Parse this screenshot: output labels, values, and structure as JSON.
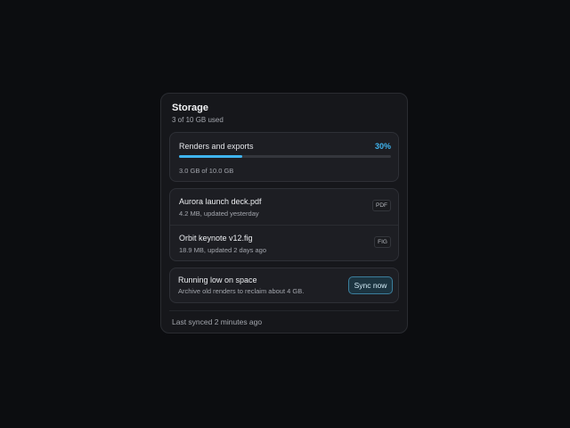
{
  "storage": {
    "title": "Storage",
    "subtitle": "3 of 10 GB used"
  },
  "usage": {
    "label": "Renders and exports",
    "percent_text": "30%",
    "fraction": 0.3,
    "detail": "3.0 GB of 10.0 GB",
    "accent_color": "#3fb4ef"
  },
  "files": [
    {
      "name": "Aurora launch deck.pdf",
      "meta": "4.2 MB, updated yesterday",
      "tag": "PDF"
    },
    {
      "name": "Orbit keynote v12.fig",
      "meta": "18.9 MB, updated 2 days ago",
      "tag": "FIG"
    }
  ],
  "alert": {
    "title": "Running low on space",
    "text": "Archive old renders to reclaim about 4 GB.",
    "button_label": "Sync now"
  },
  "footer": {
    "text": "Last synced 2 minutes ago"
  }
}
